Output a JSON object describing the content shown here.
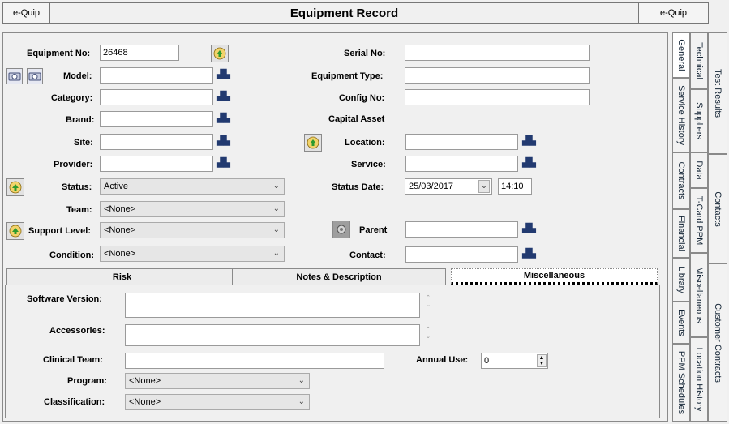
{
  "window": {
    "left_button": "e-Quip",
    "title": "Equipment Record",
    "right_button": "e-Quip"
  },
  "form": {
    "equipment_no": {
      "label": "Equipment No:",
      "value": "26468"
    },
    "model": {
      "label": "Model:",
      "value": ""
    },
    "category": {
      "label": "Category:",
      "value": ""
    },
    "brand": {
      "label": "Brand:",
      "value": ""
    },
    "site": {
      "label": "Site:",
      "value": ""
    },
    "provider": {
      "label": "Provider:",
      "value": ""
    },
    "status": {
      "label": "Status:",
      "value": "Active"
    },
    "team": {
      "label": "Team:",
      "value": "<None>"
    },
    "support_level": {
      "label": "Support Level:",
      "value": "<None>"
    },
    "condition": {
      "label": "Condition:",
      "value": "<None>"
    },
    "serial_no": {
      "label": "Serial No:",
      "value": ""
    },
    "equipment_type": {
      "label": "Equipment Type:",
      "value": ""
    },
    "config_no": {
      "label": "Config No:",
      "value": ""
    },
    "capital_asset": {
      "label": "Capital Asset"
    },
    "location": {
      "label": "Location:",
      "value": ""
    },
    "service": {
      "label": "Service:",
      "value": ""
    },
    "status_date": {
      "label": "Status Date:",
      "date": "25/03/2017",
      "time": "14:10"
    },
    "parent": {
      "label": "Parent",
      "value": ""
    },
    "contact": {
      "label": "Contact:",
      "value": ""
    }
  },
  "tabs": [
    {
      "label": "Risk"
    },
    {
      "label": "Notes & Description"
    },
    {
      "label": "Miscellaneous"
    }
  ],
  "misc": {
    "software_version": {
      "label": "Software Version:",
      "value": ""
    },
    "accessories": {
      "label": "Accessories:",
      "value": ""
    },
    "clinical_team": {
      "label": "Clinical Team:",
      "value": ""
    },
    "annual_use": {
      "label": "Annual Use:",
      "value": "0"
    },
    "program": {
      "label": "Program:",
      "value": "<None>"
    },
    "classification": {
      "label": "Classification:",
      "value": "<None>"
    }
  },
  "side_tabs": {
    "col1": [
      "General",
      "Service History",
      "Contracts",
      "Financial",
      "Library",
      "Events",
      "PPM Schedules"
    ],
    "col2": [
      "Technical",
      "Suppliers",
      "Data",
      "T-Card PPM",
      "Miscellaneous",
      "Location History"
    ],
    "col3": [
      "Test Results",
      "Contacts",
      "Customer Contracts"
    ]
  },
  "icons": {
    "lookup": "binoculars-icon",
    "refresh": "green-arrow-icon",
    "camera": "camera-icon",
    "parent": "gear-icon"
  }
}
